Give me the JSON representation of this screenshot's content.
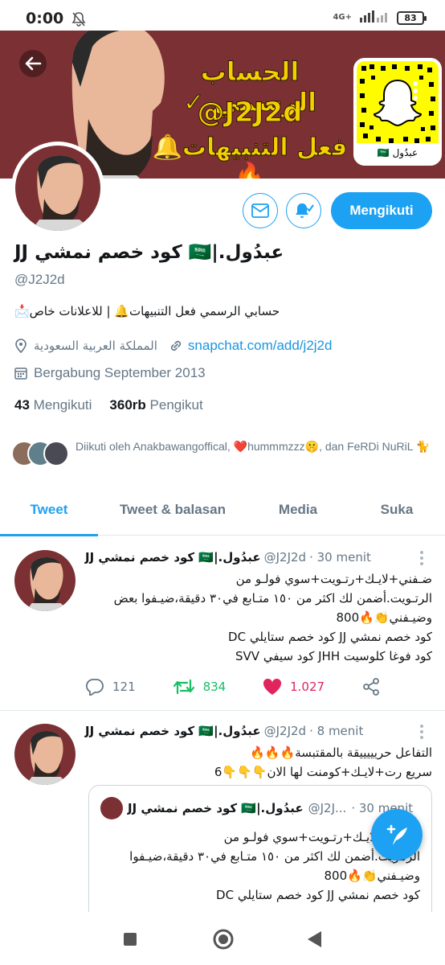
{
  "status_bar": {
    "time": "0:00",
    "network": "4G+",
    "battery": "83"
  },
  "banner": {
    "line1": "الحساب الرسمي ✓",
    "line2": "@J2J2d",
    "line3": "فعل التنبيهات🔔🔥",
    "snapcode_caption": "عبدُول 🇸🇦"
  },
  "actions": {
    "follow_label": "Mengikuti"
  },
  "profile": {
    "name": "عبدُول.|🇸🇦 كود خصم نمشي JJ",
    "handle": "@J2J2d",
    "bio": "حسابي الرسمي فعل التنبيهات🔔 | للاعلانات خاص📩",
    "location": "المملكة العربية السعودية",
    "website": "snapchat.com/add/j2j2d",
    "joined": "Bergabung September 2013",
    "following_count": "43",
    "following_label": "Mengikuti",
    "followers_count": "360rb",
    "followers_label": "Pengikut",
    "followed_by": "Diikuti oleh Anakbawangoffical, ❤️hummmzzz🤫, dan FeRDi NuRiL 🐈"
  },
  "tabs": [
    {
      "label": "Tweet",
      "active": true
    },
    {
      "label": "Tweet & balasan",
      "active": false
    },
    {
      "label": "Media",
      "active": false
    },
    {
      "label": "Suka",
      "active": false
    }
  ],
  "tweets": [
    {
      "name": "عبدُول.|🇸🇦 كود خصم نمشي JJ",
      "handle": "@J2J2d",
      "time": "· 30 menit",
      "lines": [
        "ضـفني+لايـك+رتـويت+سوي فولـو من",
        "الرتـويت.أضمن لك اكثر من ١٥٠ متـابع في٣٠ دقيقة،ضيـفوا بعض",
        "وضيـفني👏🔥800",
        "كود خصم نمشي JJ كود خصم ستايلي DC",
        "كود فوغا كلوسيت JHH كود سيفي SVV"
      ],
      "replies": "121",
      "retweets": "834",
      "likes": "1.027"
    },
    {
      "name": "عبدُول.|🇸🇦 كود خصم نمشي JJ",
      "handle": "@J2J2d",
      "time": "· 8 menit",
      "lines": [
        "التفاعل حريييييقة بالمقتبسة🔥🔥🔥",
        "سريع رت+لايـك+كومنت لها الان👇👇👇6"
      ]
    }
  ],
  "quote": {
    "name": "عبدُول.|🇸🇦 كود خصم نمشي JJ",
    "handle": "@J2J...",
    "time": "· 30 menit",
    "lines": [
      "ضـفني+لايـك+رتـويت+سوي فولـو من",
      "الرتـويت.أضمن لك اكثر من ١٥٠ متـابع في٣٠ دقيقة،ضيـفوا",
      "وضيـفني👏🔥800",
      "كود خصم نمشي JJ كود خصم ستايلي DC"
    ]
  },
  "colors": {
    "accent": "#1da1f2",
    "banner": "#7b3034",
    "like": "#e0245e",
    "retweet": "#17bf63"
  }
}
